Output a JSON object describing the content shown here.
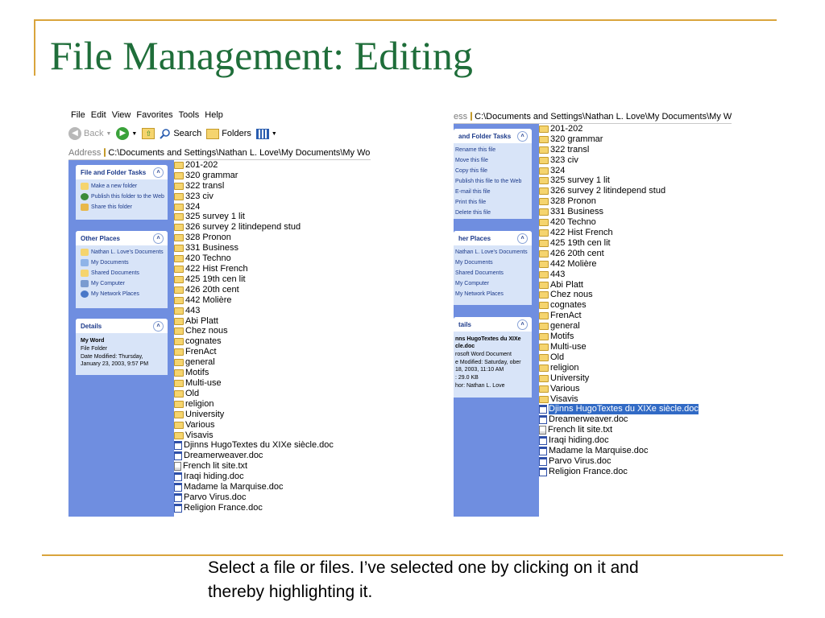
{
  "slide": {
    "title": "File Management: Editing",
    "caption": "Select a file or files. I’ve selected one by clicking on it and thereby highlighting it."
  },
  "left_window": {
    "menu": [
      "File",
      "Edit",
      "View",
      "Favorites",
      "Tools",
      "Help"
    ],
    "toolbar": {
      "back_label": "Back",
      "search_label": "Search",
      "folders_label": "Folders"
    },
    "address": {
      "label": "Address",
      "path": "C:\\Documents and Settings\\Nathan L. Love\\My Documents\\My Word"
    },
    "tasks_panel": {
      "title": "File and Folder Tasks",
      "items": [
        {
          "label": "Make a new folder",
          "icon": "new-folder-icon"
        },
        {
          "label": "Publish this folder to the Web",
          "icon": "globe-icon"
        },
        {
          "label": "Share this folder",
          "icon": "share-folder-icon"
        }
      ]
    },
    "places_panel": {
      "title": "Other Places",
      "items": [
        {
          "label": "Nathan L. Love's Documents",
          "icon": "folder-icon"
        },
        {
          "label": "My Documents",
          "icon": "documents-icon"
        },
        {
          "label": "Shared Documents",
          "icon": "folder-icon"
        },
        {
          "label": "My Computer",
          "icon": "computer-icon"
        },
        {
          "label": "My Network Places",
          "icon": "network-icon"
        }
      ]
    },
    "details_panel": {
      "title": "Details",
      "name": "My Word",
      "type": "File Folder",
      "modified": "Date Modified: Thursday, January 23, 2003, 9:57 PM"
    },
    "files": [
      {
        "name": "201-202",
        "type": "folder"
      },
      {
        "name": "320 grammar",
        "type": "folder"
      },
      {
        "name": "322 transl",
        "type": "folder"
      },
      {
        "name": "323 civ",
        "type": "folder"
      },
      {
        "name": "324",
        "type": "folder"
      },
      {
        "name": "325 survey 1 lit",
        "type": "folder"
      },
      {
        "name": "326 survey 2 litindepend stud",
        "type": "folder"
      },
      {
        "name": "328 Pronon",
        "type": "folder"
      },
      {
        "name": "331 Business",
        "type": "folder"
      },
      {
        "name": "420 Techno",
        "type": "folder"
      },
      {
        "name": "422 Hist French",
        "type": "folder"
      },
      {
        "name": "425 19th cen lit",
        "type": "folder"
      },
      {
        "name": "426 20th cent",
        "type": "folder"
      },
      {
        "name": "442 Molière",
        "type": "folder"
      },
      {
        "name": "443",
        "type": "folder"
      },
      {
        "name": "Abi Platt",
        "type": "folder"
      },
      {
        "name": "Chez nous",
        "type": "folder"
      },
      {
        "name": "cognates",
        "type": "folder"
      },
      {
        "name": "FrenAct",
        "type": "folder"
      },
      {
        "name": "general",
        "type": "folder"
      },
      {
        "name": "Motifs",
        "type": "folder"
      },
      {
        "name": "Multi-use",
        "type": "folder"
      },
      {
        "name": "Old",
        "type": "folder"
      },
      {
        "name": "religion",
        "type": "folder"
      },
      {
        "name": "University",
        "type": "folder"
      },
      {
        "name": "Various",
        "type": "folder"
      },
      {
        "name": "Visavis",
        "type": "folder"
      },
      {
        "name": "Djinns HugoTextes du XIXe siècle.doc",
        "type": "doc"
      },
      {
        "name": "Dreamerweaver.doc",
        "type": "doc"
      },
      {
        "name": "French lit site.txt",
        "type": "txt"
      },
      {
        "name": "Iraqi hiding.doc",
        "type": "doc"
      },
      {
        "name": "Madame la Marquise.doc",
        "type": "doc"
      },
      {
        "name": "Parvo Virus.doc",
        "type": "doc"
      },
      {
        "name": "Religion France.doc",
        "type": "doc"
      }
    ]
  },
  "right_window": {
    "address": {
      "label": "ess",
      "path": "C:\\Documents and Settings\\Nathan L. Love\\My Documents\\My Word"
    },
    "tasks_panel": {
      "title": "and Folder Tasks",
      "items": [
        "Rename this file",
        "Move this file",
        "Copy this file",
        "Publish this file to the Web",
        "E-mail this file",
        "Print this file",
        "Delete this file"
      ]
    },
    "places_panel": {
      "title": "her Places",
      "items": [
        "Nathan L. Love's Documents",
        "My Documents",
        "Shared Documents",
        "My Computer",
        "My Network Places"
      ]
    },
    "details_panel": {
      "title": "tails",
      "name": "nns HugoTextes du XIXe cle.doc",
      "type": "rosoft Word Document",
      "modified": "e Modified: Saturday, ober 18, 2003, 11:10 AM",
      "size": ": 29.0 KB",
      "author": "hor: Nathan L. Love"
    },
    "selected_index": 27,
    "files": [
      {
        "name": "201-202",
        "type": "folder"
      },
      {
        "name": "320 grammar",
        "type": "folder"
      },
      {
        "name": "322 transl",
        "type": "folder"
      },
      {
        "name": "323 civ",
        "type": "folder"
      },
      {
        "name": "324",
        "type": "folder"
      },
      {
        "name": "325 survey 1 lit",
        "type": "folder"
      },
      {
        "name": "326 survey 2 litindepend stud",
        "type": "folder"
      },
      {
        "name": "328 Pronon",
        "type": "folder"
      },
      {
        "name": "331 Business",
        "type": "folder"
      },
      {
        "name": "420 Techno",
        "type": "folder"
      },
      {
        "name": "422 Hist French",
        "type": "folder"
      },
      {
        "name": "425 19th cen lit",
        "type": "folder"
      },
      {
        "name": "426 20th cent",
        "type": "folder"
      },
      {
        "name": "442 Molière",
        "type": "folder"
      },
      {
        "name": "443",
        "type": "folder"
      },
      {
        "name": "Abi Platt",
        "type": "folder"
      },
      {
        "name": "Chez nous",
        "type": "folder"
      },
      {
        "name": "cognates",
        "type": "folder"
      },
      {
        "name": "FrenAct",
        "type": "folder"
      },
      {
        "name": "general",
        "type": "folder"
      },
      {
        "name": "Motifs",
        "type": "folder"
      },
      {
        "name": "Multi-use",
        "type": "folder"
      },
      {
        "name": "Old",
        "type": "folder"
      },
      {
        "name": "religion",
        "type": "folder"
      },
      {
        "name": "University",
        "type": "folder"
      },
      {
        "name": "Various",
        "type": "folder"
      },
      {
        "name": "Visavis",
        "type": "folder"
      },
      {
        "name": "Djinns HugoTextes du XIXe siècle.doc",
        "type": "doc"
      },
      {
        "name": "Dreamerweaver.doc",
        "type": "doc"
      },
      {
        "name": "French lit site.txt",
        "type": "txt"
      },
      {
        "name": "Iraqi hiding.doc",
        "type": "doc"
      },
      {
        "name": "Madame la Marquise.doc",
        "type": "doc"
      },
      {
        "name": "Parvo Virus.doc",
        "type": "doc"
      },
      {
        "name": "Religion France.doc",
        "type": "doc"
      }
    ]
  },
  "colors": {
    "title": "#1f6e3a",
    "rule": "#d9a43c",
    "taskpane": "#6f8ee0",
    "selection": "#316ac5"
  }
}
